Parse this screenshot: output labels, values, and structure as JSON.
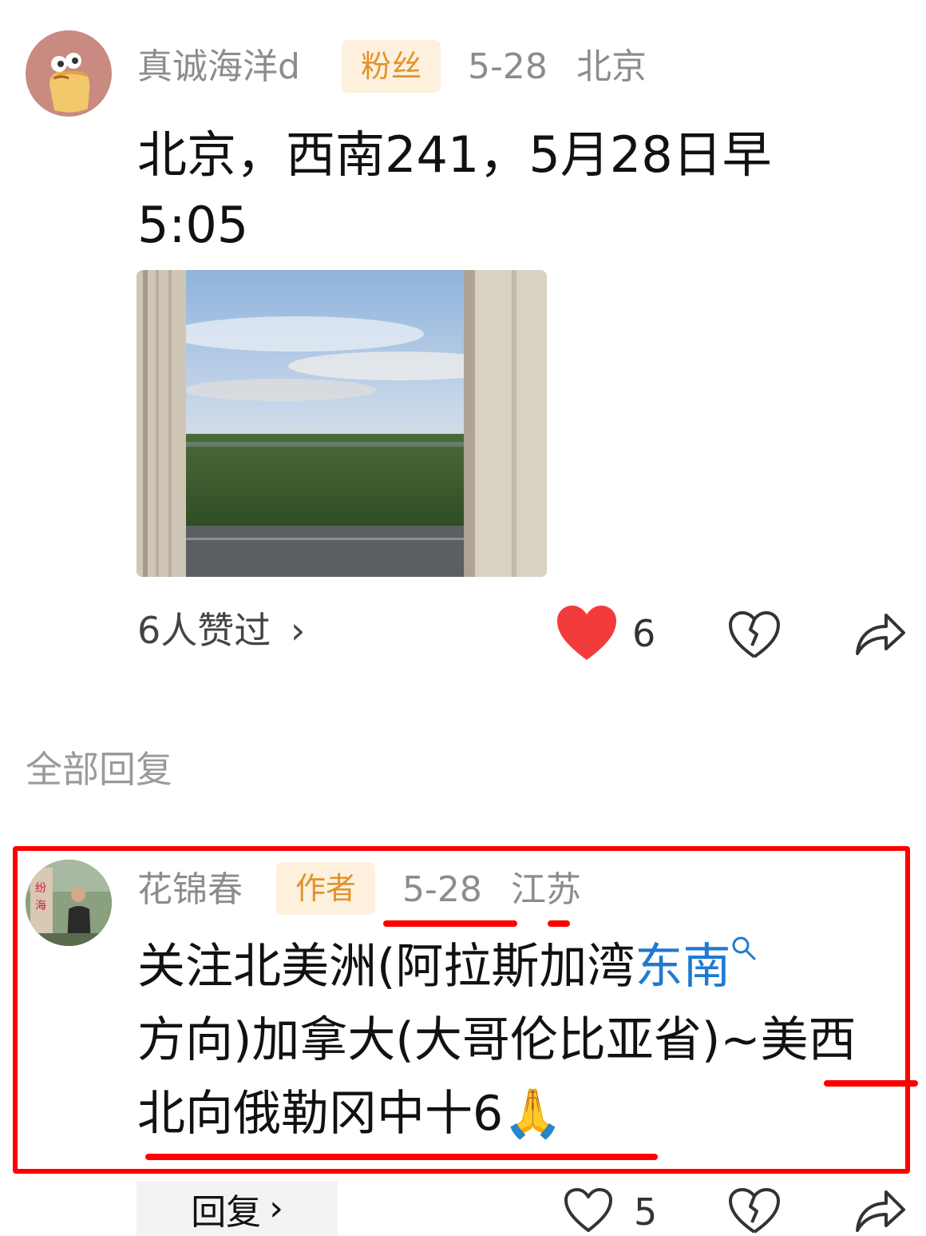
{
  "post": {
    "user_name": "真诚海洋d",
    "badge": "粉丝",
    "date": "5-28",
    "location": "北京",
    "text": "北京，西南241，5月28日早5:05",
    "likes_summary": "6人赞过",
    "like_count": "6",
    "colors": {
      "liked_heart": "#f33b3b",
      "badge_bg": "#fdf0dd",
      "badge_text": "#e2922a"
    }
  },
  "replies_section": {
    "title": "全部回复"
  },
  "reply": {
    "user_name": "花锦春",
    "badge": "作者",
    "date": "5-28",
    "location": "江苏",
    "text_part1": "关注北美洲(阿拉斯加湾",
    "keyword": "东南",
    "text_part2": "方向)加拿大(大哥伦比亚省)~美西北向俄勒冈中十6",
    "emoji": "🙏",
    "reply_button": "回复",
    "like_count": "5",
    "colors": {
      "keyword_link": "#1f7ad1",
      "annotation_red": "#ff0000"
    }
  },
  "icons": {
    "chevron": "›",
    "heart_filled": "heart-filled-icon",
    "heart_outline": "heart-outline-icon",
    "broken_heart": "broken-heart-icon",
    "share": "share-icon",
    "search": "search-icon"
  }
}
